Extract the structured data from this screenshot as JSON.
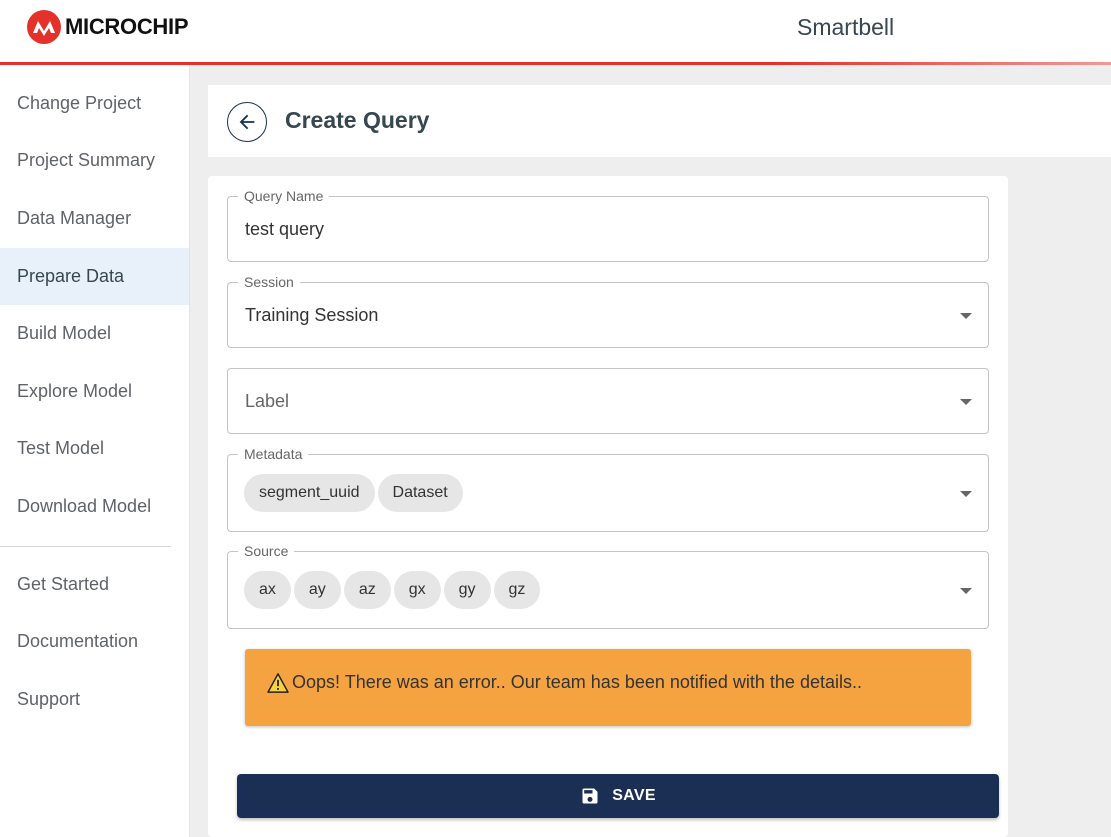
{
  "header": {
    "logo_text": "MICROCHIP",
    "app_name": "Smartbell",
    "accent_color": "#e4312b"
  },
  "sidebar": {
    "items": [
      {
        "label": "Change Project",
        "active": false
      },
      {
        "label": "Project Summary",
        "active": false
      },
      {
        "label": "Data Manager",
        "active": false
      },
      {
        "label": "Prepare Data",
        "active": true
      },
      {
        "label": "Build Model",
        "active": false
      },
      {
        "label": "Explore Model",
        "active": false
      },
      {
        "label": "Test Model",
        "active": false
      },
      {
        "label": "Download Model",
        "active": false
      }
    ],
    "secondary_items": [
      {
        "label": "Get Started"
      },
      {
        "label": "Documentation"
      },
      {
        "label": "Support"
      }
    ]
  },
  "page": {
    "title": "Create Query",
    "back_icon": "arrow-left-icon"
  },
  "form": {
    "query_name": {
      "label": "Query Name",
      "value": "test query"
    },
    "session": {
      "label": "Session",
      "value": "Training Session"
    },
    "label_field": {
      "placeholder": "Label"
    },
    "metadata": {
      "label": "Metadata",
      "chips": [
        "segment_uuid",
        "Dataset"
      ]
    },
    "source": {
      "label": "Source",
      "chips": [
        "ax",
        "ay",
        "az",
        "gx",
        "gy",
        "gz"
      ]
    }
  },
  "error": {
    "icon": "warning-icon",
    "message": "Oops! There was an error.. Our team has been notified with the details..",
    "color": "#f5a340"
  },
  "save_button": {
    "label": "SAVE",
    "icon": "floppy-disk-icon",
    "color": "#1b2f55"
  }
}
